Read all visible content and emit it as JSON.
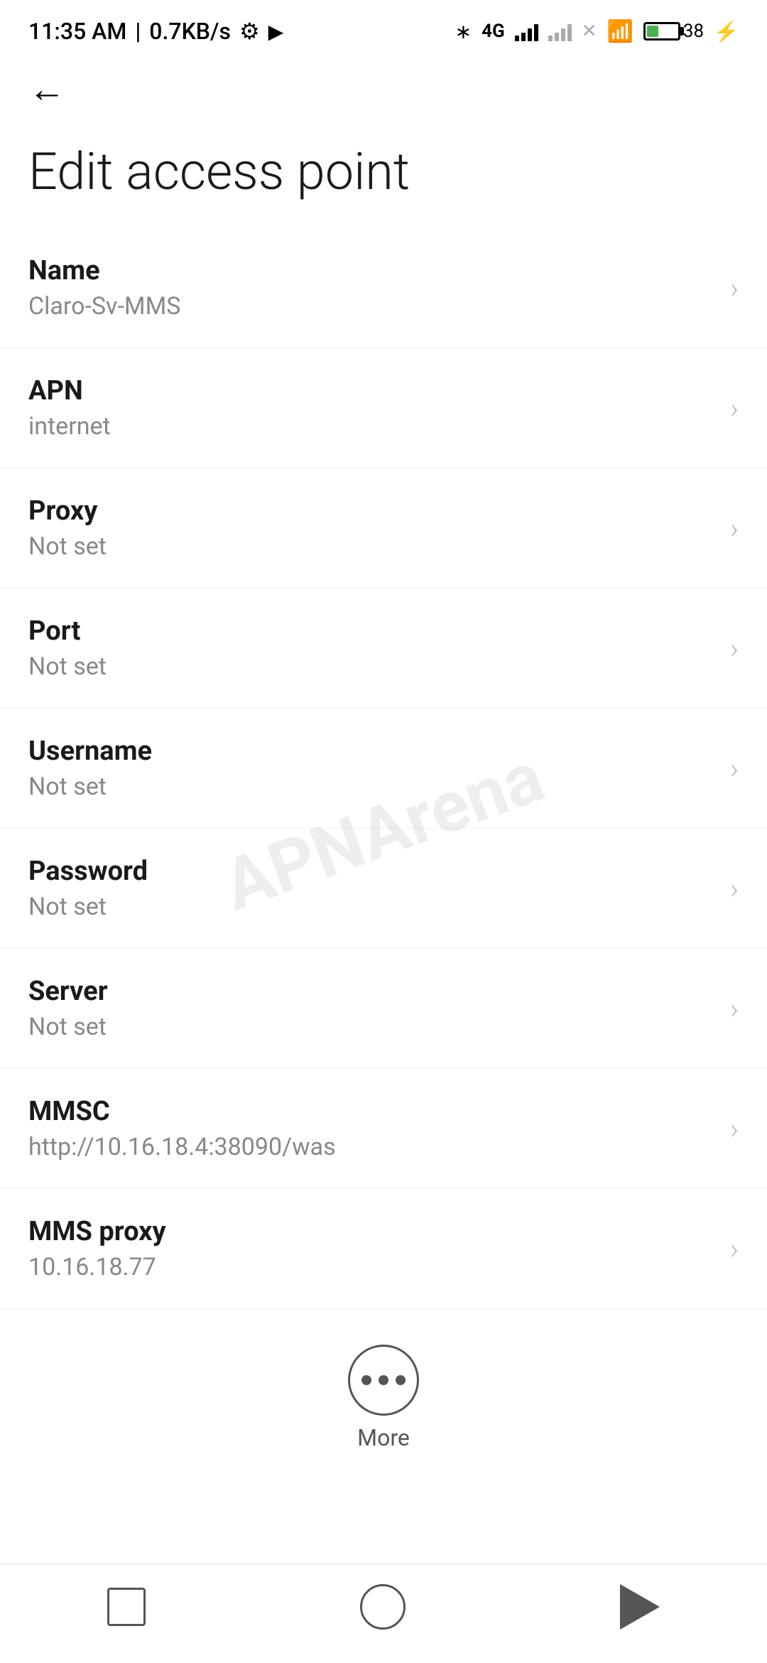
{
  "statusBar": {
    "time": "11:35 AM",
    "network": "0.7KB/s",
    "battery": "38"
  },
  "nav": {
    "backLabel": "←"
  },
  "page": {
    "title": "Edit access point"
  },
  "settings": {
    "items": [
      {
        "label": "Name",
        "value": "Claro-Sv-MMS"
      },
      {
        "label": "APN",
        "value": "internet"
      },
      {
        "label": "Proxy",
        "value": "Not set"
      },
      {
        "label": "Port",
        "value": "Not set"
      },
      {
        "label": "Username",
        "value": "Not set"
      },
      {
        "label": "Password",
        "value": "Not set"
      },
      {
        "label": "Server",
        "value": "Not set"
      },
      {
        "label": "MMSC",
        "value": "http://10.16.18.4:38090/was"
      },
      {
        "label": "MMS proxy",
        "value": "10.16.18.77"
      }
    ]
  },
  "more": {
    "label": "More"
  },
  "bottomNav": {
    "square": "square",
    "circle": "circle",
    "triangle": "triangle"
  },
  "watermark": "APNArena"
}
